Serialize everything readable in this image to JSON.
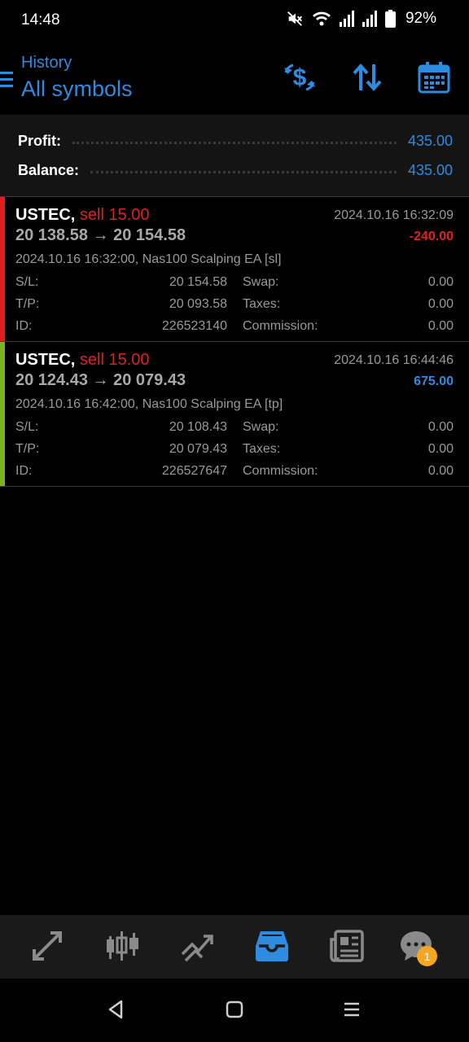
{
  "status_bar": {
    "time": "14:48",
    "battery": "92%",
    "icons": [
      "mute-icon",
      "wifi-icon",
      "signal-icon",
      "signal-icon",
      "battery-icon"
    ]
  },
  "header": {
    "subtitle": "History",
    "title": "All symbols",
    "icons": [
      "menu-icon",
      "currency-exchange-icon",
      "sort-icon",
      "calendar-icon"
    ]
  },
  "summary": {
    "profit_label": "Profit:",
    "profit_value": "435.00",
    "balance_label": "Balance:",
    "balance_value": "435.00"
  },
  "deals": [
    {
      "symbol": "USTEC,",
      "side": "sell 15.00",
      "time": "2024.10.16 16:32:09",
      "prices": "20 138.58 → 20 154.58",
      "profit": "-240.00",
      "profit_color": "#e02020",
      "bar_color": "#e01e1e",
      "comment": "2024.10.16 16:32:00, Nas100 Scalping EA [sl]",
      "sl_label": "S/L:",
      "sl": "20 154.58",
      "tp_label": "T/P:",
      "tp": "20 093.58",
      "id_label": "ID:",
      "id": "226523140",
      "swap_label": "Swap:",
      "swap": "0.00",
      "taxes_label": "Taxes:",
      "taxes": "0.00",
      "commission_label": "Commission:",
      "commission": "0.00"
    },
    {
      "symbol": "USTEC,",
      "side": "sell 15.00",
      "time": "2024.10.16 16:44:46",
      "prices": "20 124.43 → 20 079.43",
      "profit": "675.00",
      "profit_color": "#2e8bdf",
      "bar_color": "#7bb21f",
      "comment": "2024.10.16 16:42:00, Nas100 Scalping EA [tp]",
      "sl_label": "S/L:",
      "sl": "20 108.43",
      "tp_label": "T/P:",
      "tp": "20 079.43",
      "id_label": "ID:",
      "id": "226527647",
      "swap_label": "Swap:",
      "swap": "0.00",
      "taxes_label": "Taxes:",
      "taxes": "0.00",
      "commission_label": "Commission:",
      "commission": "0.00"
    }
  ],
  "bottom_nav": {
    "items": [
      "quotes-icon",
      "chart-icon",
      "trade-icon",
      "history-icon",
      "news-icon",
      "messages-icon"
    ],
    "active": "history-icon",
    "messages_badge": "1",
    "active_color": "#2e8bdf",
    "inactive_color": "#8a8a8a"
  },
  "system_nav": [
    "back-icon",
    "home-icon",
    "recents-icon"
  ]
}
